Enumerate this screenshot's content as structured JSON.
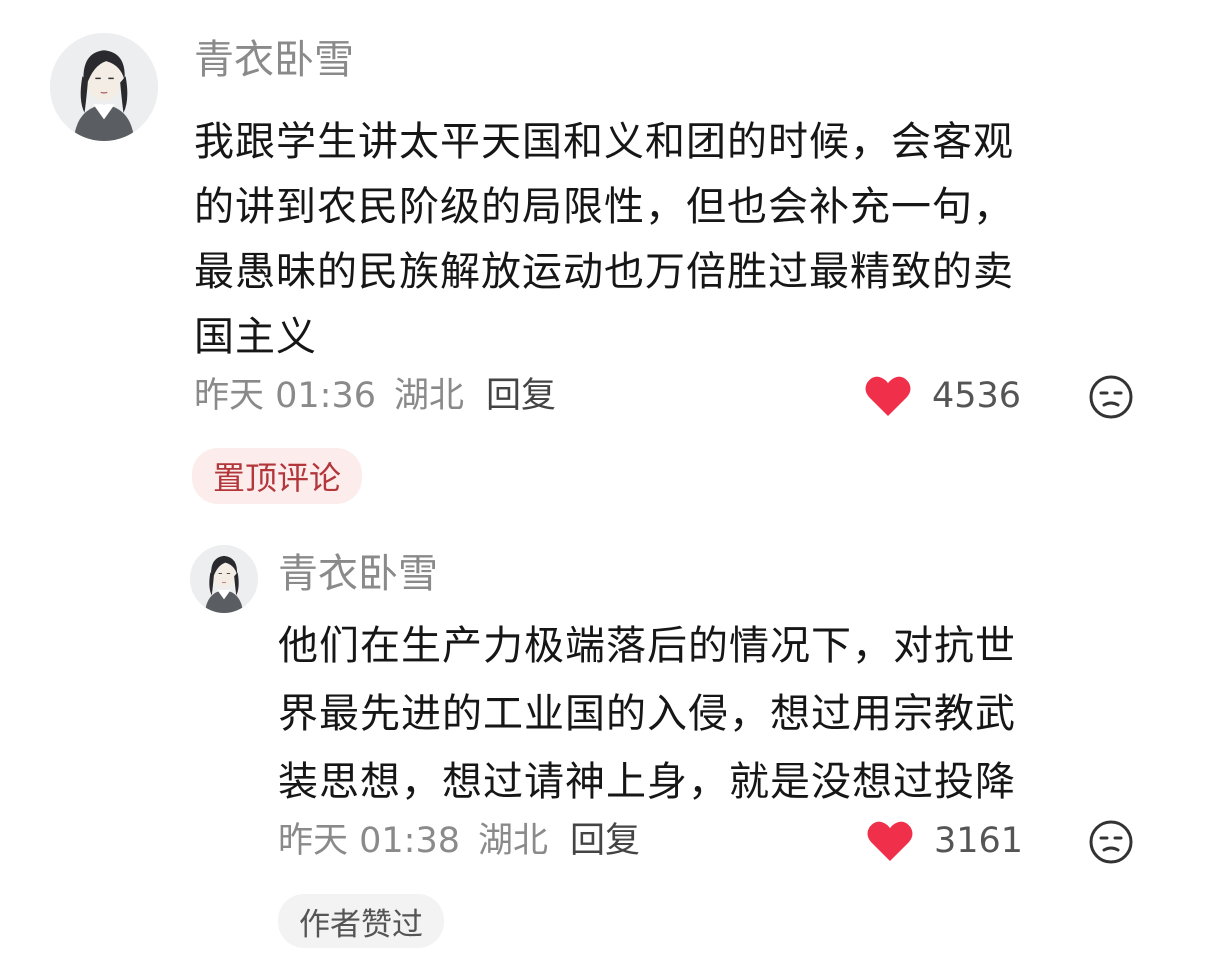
{
  "comments": [
    {
      "username": "青衣卧雪",
      "content_lines": [
        "我跟学生讲太平天国和义和团的时候，会客观",
        "的讲到农民阶级的局限性，但也会补充一句，",
        "最愚昧的民族解放运动也万倍胜过最精致的卖",
        "国主义"
      ],
      "time": "昨天 01:36",
      "location": "湖北",
      "reply_label": "回复",
      "likes": "4536",
      "badge": "置顶评论"
    },
    {
      "username": "青衣卧雪",
      "content_lines": [
        "他们在生产力极端落后的情况下，对抗世",
        "界最先进的工业国的入侵，想过用宗教武",
        "装思想，想过请神上身，就是没想过投降"
      ],
      "time": "昨天 01:38",
      "location": "湖北",
      "reply_label": "回复",
      "likes": "3161",
      "badge": "作者赞过"
    }
  ],
  "colors": {
    "heart": "#f0304a",
    "muted": "#8a8a8a",
    "pinned_bg": "#fcecec",
    "pinned_text": "#b2363a"
  },
  "icons": [
    "avatar",
    "heart-icon",
    "dislike-face-icon"
  ]
}
